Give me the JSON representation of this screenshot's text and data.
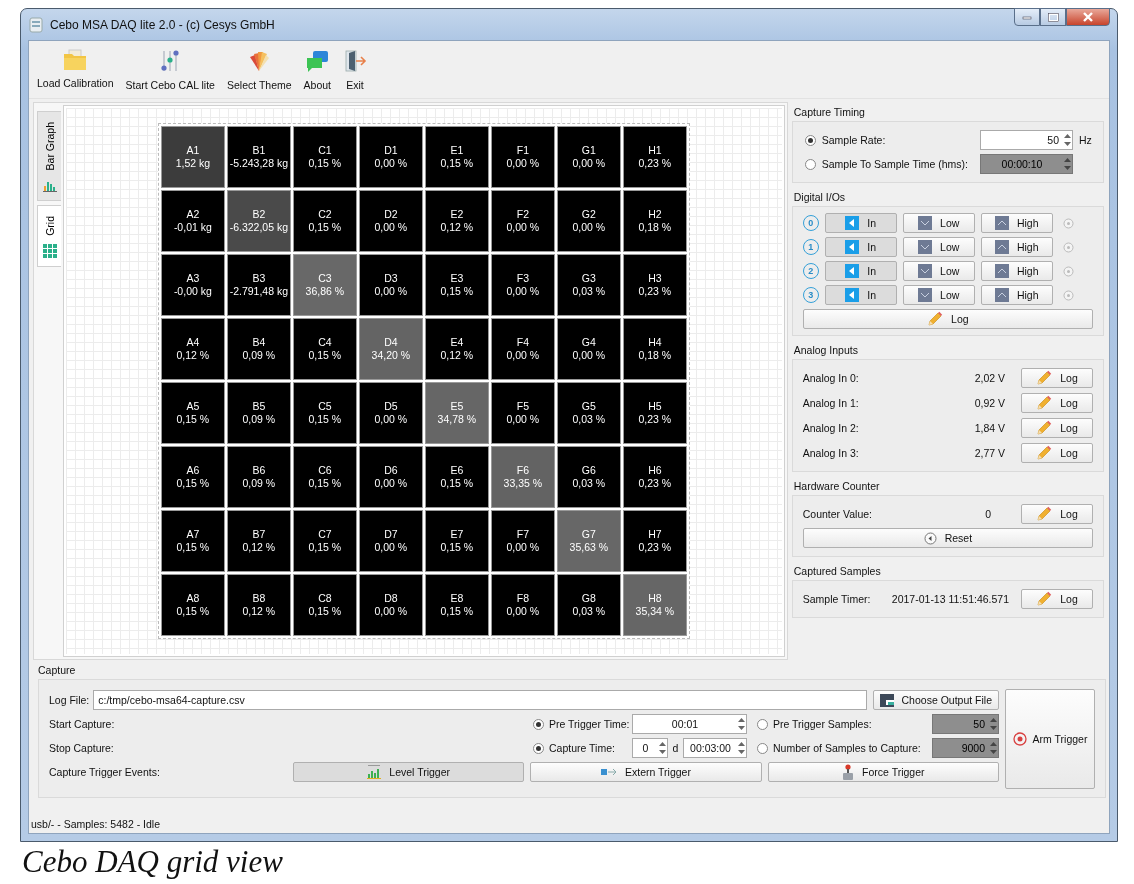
{
  "window": {
    "title": "Cebo MSA DAQ lite 2.0 - (c) Cesys GmbH"
  },
  "toolbar": [
    {
      "label": "Load Calibration",
      "kind": "folder"
    },
    {
      "label": "Start Cebo CAL lite",
      "kind": "sliders"
    },
    {
      "label": "Select Theme",
      "kind": "theme"
    },
    {
      "label": "About",
      "kind": "chat"
    },
    {
      "label": "Exit",
      "kind": "exit"
    }
  ],
  "view_tabs": [
    {
      "label": "Bar Graph",
      "kind": "bars",
      "selected": false
    },
    {
      "label": "Grid",
      "kind": "grid",
      "selected": true
    }
  ],
  "grid": {
    "rows": [
      {
        "cells": [
          {
            "name": "A1",
            "value": "1,52 kg",
            "color": "#3c3c3c"
          },
          {
            "name": "B1",
            "value": "-5.243,28 kg",
            "color": "#000000"
          },
          {
            "name": "C1",
            "value": "0,15 %",
            "color": "#000000"
          },
          {
            "name": "D1",
            "value": "0,00 %",
            "color": "#000000"
          },
          {
            "name": "E1",
            "value": "0,15 %",
            "color": "#000000"
          },
          {
            "name": "F1",
            "value": "0,00 %",
            "color": "#000000"
          },
          {
            "name": "G1",
            "value": "0,00 %",
            "color": "#000000"
          },
          {
            "name": "H1",
            "value": "0,23 %",
            "color": "#000000"
          }
        ]
      },
      {
        "cells": [
          {
            "name": "A2",
            "value": "-0,01 kg",
            "color": "#000000"
          },
          {
            "name": "B2",
            "value": "-6.322,05 kg",
            "color": "#4a4a4a"
          },
          {
            "name": "C2",
            "value": "0,15 %",
            "color": "#000000"
          },
          {
            "name": "D2",
            "value": "0,00 %",
            "color": "#000000"
          },
          {
            "name": "E2",
            "value": "0,12 %",
            "color": "#000000"
          },
          {
            "name": "F2",
            "value": "0,00 %",
            "color": "#000000"
          },
          {
            "name": "G2",
            "value": "0,00 %",
            "color": "#000000"
          },
          {
            "name": "H2",
            "value": "0,18 %",
            "color": "#000000"
          }
        ]
      },
      {
        "cells": [
          {
            "name": "A3",
            "value": "-0,00 kg",
            "color": "#000000"
          },
          {
            "name": "B3",
            "value": "-2.791,48 kg",
            "color": "#000000"
          },
          {
            "name": "C3",
            "value": "36,86 %",
            "color": "#686868"
          },
          {
            "name": "D3",
            "value": "0,00 %",
            "color": "#000000"
          },
          {
            "name": "E3",
            "value": "0,15 %",
            "color": "#000000"
          },
          {
            "name": "F3",
            "value": "0,00 %",
            "color": "#000000"
          },
          {
            "name": "G3",
            "value": "0,03 %",
            "color": "#000000"
          },
          {
            "name": "H3",
            "value": "0,23 %",
            "color": "#000000"
          }
        ]
      },
      {
        "cells": [
          {
            "name": "A4",
            "value": "0,12 %",
            "color": "#000000"
          },
          {
            "name": "B4",
            "value": "0,09 %",
            "color": "#000000"
          },
          {
            "name": "C4",
            "value": "0,15 %",
            "color": "#000000"
          },
          {
            "name": "D4",
            "value": "34,20 %",
            "color": "#646464"
          },
          {
            "name": "E4",
            "value": "0,12 %",
            "color": "#000000"
          },
          {
            "name": "F4",
            "value": "0,00 %",
            "color": "#000000"
          },
          {
            "name": "G4",
            "value": "0,00 %",
            "color": "#000000"
          },
          {
            "name": "H4",
            "value": "0,18 %",
            "color": "#000000"
          }
        ]
      },
      {
        "cells": [
          {
            "name": "A5",
            "value": "0,15 %",
            "color": "#000000"
          },
          {
            "name": "B5",
            "value": "0,09 %",
            "color": "#000000"
          },
          {
            "name": "C5",
            "value": "0,15 %",
            "color": "#000000"
          },
          {
            "name": "D5",
            "value": "0,00 %",
            "color": "#000000"
          },
          {
            "name": "E5",
            "value": "34,78 %",
            "color": "#666666"
          },
          {
            "name": "F5",
            "value": "0,00 %",
            "color": "#000000"
          },
          {
            "name": "G5",
            "value": "0,03 %",
            "color": "#000000"
          },
          {
            "name": "H5",
            "value": "0,23 %",
            "color": "#000000"
          }
        ]
      },
      {
        "cells": [
          {
            "name": "A6",
            "value": "0,15 %",
            "color": "#000000"
          },
          {
            "name": "B6",
            "value": "0,09 %",
            "color": "#000000"
          },
          {
            "name": "C6",
            "value": "0,15 %",
            "color": "#000000"
          },
          {
            "name": "D6",
            "value": "0,00 %",
            "color": "#000000"
          },
          {
            "name": "E6",
            "value": "0,15 %",
            "color": "#000000"
          },
          {
            "name": "F6",
            "value": "33,35 %",
            "color": "#636363"
          },
          {
            "name": "G6",
            "value": "0,03 %",
            "color": "#000000"
          },
          {
            "name": "H6",
            "value": "0,23 %",
            "color": "#000000"
          }
        ]
      },
      {
        "cells": [
          {
            "name": "A7",
            "value": "0,15 %",
            "color": "#000000"
          },
          {
            "name": "B7",
            "value": "0,12 %",
            "color": "#000000"
          },
          {
            "name": "C7",
            "value": "0,15 %",
            "color": "#000000"
          },
          {
            "name": "D7",
            "value": "0,00 %",
            "color": "#000000"
          },
          {
            "name": "E7",
            "value": "0,15 %",
            "color": "#000000"
          },
          {
            "name": "F7",
            "value": "0,00 %",
            "color": "#000000"
          },
          {
            "name": "G7",
            "value": "35,63 %",
            "color": "#676767"
          },
          {
            "name": "H7",
            "value": "0,23 %",
            "color": "#000000"
          }
        ]
      },
      {
        "cells": [
          {
            "name": "A8",
            "value": "0,15 %",
            "color": "#000000"
          },
          {
            "name": "B8",
            "value": "0,12 %",
            "color": "#000000"
          },
          {
            "name": "C8",
            "value": "0,15 %",
            "color": "#000000"
          },
          {
            "name": "D8",
            "value": "0,00 %",
            "color": "#000000"
          },
          {
            "name": "E8",
            "value": "0,15 %",
            "color": "#000000"
          },
          {
            "name": "F8",
            "value": "0,00 %",
            "color": "#000000"
          },
          {
            "name": "G8",
            "value": "0,03 %",
            "color": "#000000"
          },
          {
            "name": "H8",
            "value": "35,34 %",
            "color": "#666666"
          }
        ]
      }
    ]
  },
  "capture_timing": {
    "title": "Capture Timing",
    "options": [
      {
        "label": "Sample Rate:",
        "selected": true,
        "value": "50",
        "disabled": false,
        "unit": "Hz"
      },
      {
        "label": "Sample To Sample Time (hms):",
        "selected": false,
        "value": "00:00:10",
        "disabled": true
      }
    ]
  },
  "digital_ios": {
    "title": "Digital I/Os",
    "rows": [
      {
        "number": "0",
        "buttons": [
          {
            "label": "In",
            "kind": "in",
            "pressed": true
          },
          {
            "label": "Low",
            "kind": "low",
            "pressed": false
          },
          {
            "label": "High",
            "kind": "high",
            "pressed": false
          }
        ]
      },
      {
        "number": "1",
        "buttons": [
          {
            "label": "In",
            "kind": "in",
            "pressed": true
          },
          {
            "label": "Low",
            "kind": "low",
            "pressed": false
          },
          {
            "label": "High",
            "kind": "high",
            "pressed": false
          }
        ]
      },
      {
        "number": "2",
        "buttons": [
          {
            "label": "In",
            "kind": "in",
            "pressed": true
          },
          {
            "label": "Low",
            "kind": "low",
            "pressed": false
          },
          {
            "label": "High",
            "kind": "high",
            "pressed": false
          }
        ]
      },
      {
        "number": "3",
        "buttons": [
          {
            "label": "In",
            "kind": "in",
            "pressed": true
          },
          {
            "label": "Low",
            "kind": "low",
            "pressed": false
          },
          {
            "label": "High",
            "kind": "high",
            "pressed": false
          }
        ]
      }
    ],
    "log_button": "Log"
  },
  "analog_inputs": {
    "title": "Analog Inputs",
    "rows": [
      {
        "label": "Analog In 0:",
        "value": "2,02 V",
        "button": "Log"
      },
      {
        "label": "Analog In 1:",
        "value": "0,92 V",
        "button": "Log"
      },
      {
        "label": "Analog In 2:",
        "value": "1,84 V",
        "button": "Log"
      },
      {
        "label": "Analog In 3:",
        "value": "2,77 V",
        "button": "Log"
      }
    ]
  },
  "hardware_counter": {
    "title": "Hardware Counter",
    "label": "Counter Value:",
    "value": "0",
    "button": "Log",
    "reset_button": "Reset"
  },
  "captured_samples": {
    "title": "Captured Samples",
    "label": "Sample Timer:",
    "value": "2017-01-13 11:51:46.571",
    "button": "Log"
  },
  "capture": {
    "title": "Capture",
    "log_file_label": "Log File:",
    "log_file_value": "c:/tmp/cebo-msa64-capture.csv",
    "choose_button": "Choose Output File",
    "start_label": "Start Capture:",
    "stop_label": "Stop Capture:",
    "pre_trigger_time": {
      "label": "Pre Trigger Time:",
      "selected": true,
      "value": "00:01",
      "disabled": false
    },
    "pre_trigger_samples": {
      "label": "Pre Trigger Samples:",
      "selected": false,
      "value": "50",
      "disabled": true
    },
    "capture_time": {
      "label": "Capture Time:",
      "selected": true,
      "days": "0",
      "days_unit": "d",
      "time": "00:03:00"
    },
    "samples_to_capture": {
      "label": "Number of Samples to Capture:",
      "selected": false,
      "value": "9000",
      "disabled": true
    },
    "trigger_events_label": "Capture Trigger Events:",
    "triggers": [
      {
        "label": "Level Trigger",
        "kind": "level",
        "selected": true
      },
      {
        "label": "Extern Trigger",
        "kind": "extern",
        "selected": false
      },
      {
        "label": "Force Trigger",
        "kind": "force",
        "selected": false
      }
    ],
    "arm_button": "Arm Trigger"
  },
  "status_bar": "usb/- - Samples: 5482 - Idle",
  "caption": "Cebo DAQ grid view"
}
